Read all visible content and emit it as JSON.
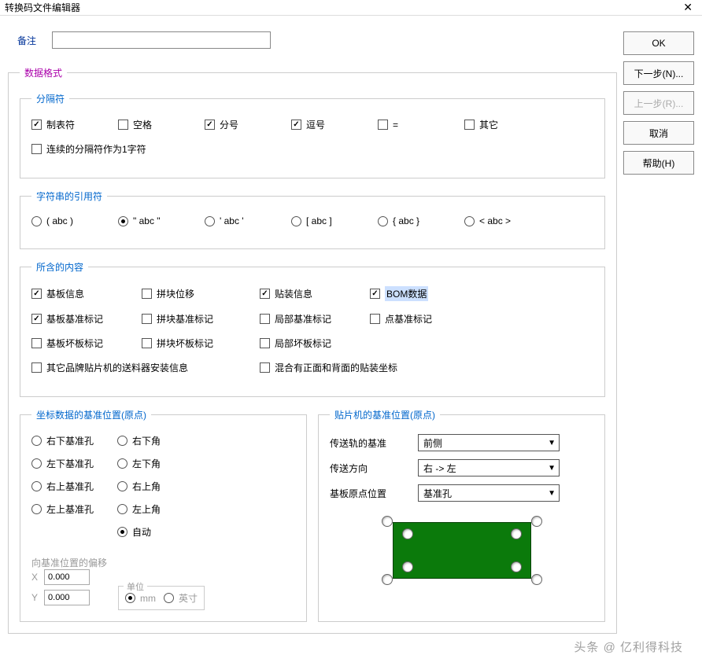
{
  "window_title": "转换码文件编辑器",
  "remark": {
    "label": "备注",
    "value": ""
  },
  "data_format": {
    "legend": "数据格式",
    "separator": {
      "legend": "分隔符",
      "tab": "制表符",
      "space": "空格",
      "semicolon": "分号",
      "comma": "逗号",
      "equals": "=",
      "other": "其它",
      "consecutive": "连续的分隔符作为1字符"
    },
    "quote": {
      "legend": "字符串的引用符",
      "paren": "( abc )",
      "dquote": "\" abc \"",
      "squote": "' abc '",
      "bracket": "[ abc ]",
      "brace": "{ abc }",
      "angle": "< abc >"
    },
    "content": {
      "legend": "所含的内容",
      "base_info": "基板信息",
      "panel_offset": "拼块位移",
      "mount_info": "贴装信息",
      "bom": "BOM数据",
      "base_fiducial": "基板基准标记",
      "panel_fiducial": "拼块基准标记",
      "local_fiducial": "局部基准标记",
      "point_fiducial": "点基准标记",
      "base_bad": "基板坏板标记",
      "panel_bad": "拼块坏板标记",
      "local_bad": "局部坏板标记",
      "other_feeder": "其它品牌贴片机的送料器安装信息",
      "mixed": "混合有正面和背面的贴装坐标"
    },
    "origin": {
      "legend": "坐标数据的基准位置(原点)",
      "rb": "右下基准孔",
      "lb": "左下基准孔",
      "rt": "右上基准孔",
      "lt": "左上基准孔",
      "rbc": "右下角",
      "lbc": "左下角",
      "rtc": "右上角",
      "ltc": "左上角",
      "auto": "自动",
      "offset_label": "向基准位置的偏移",
      "x": "X",
      "y": "Y",
      "x_val": "0.000",
      "y_val": "0.000",
      "unit_legend": "单位",
      "mm": "mm",
      "inch": "英寸"
    },
    "machine": {
      "legend": "贴片机的基准位置(原点)",
      "rail": "传送轨的基准",
      "rail_val": "前侧",
      "direction": "传送方向",
      "direction_val": "右 -> 左",
      "origin": "基板原点位置",
      "origin_val": "基准孔"
    }
  },
  "buttons": {
    "ok": "OK",
    "next": "下一步(N)...",
    "prev": "上一步(R)...",
    "cancel": "取消",
    "help": "帮助(H)"
  },
  "watermark": "头条 @ 亿利得科技"
}
